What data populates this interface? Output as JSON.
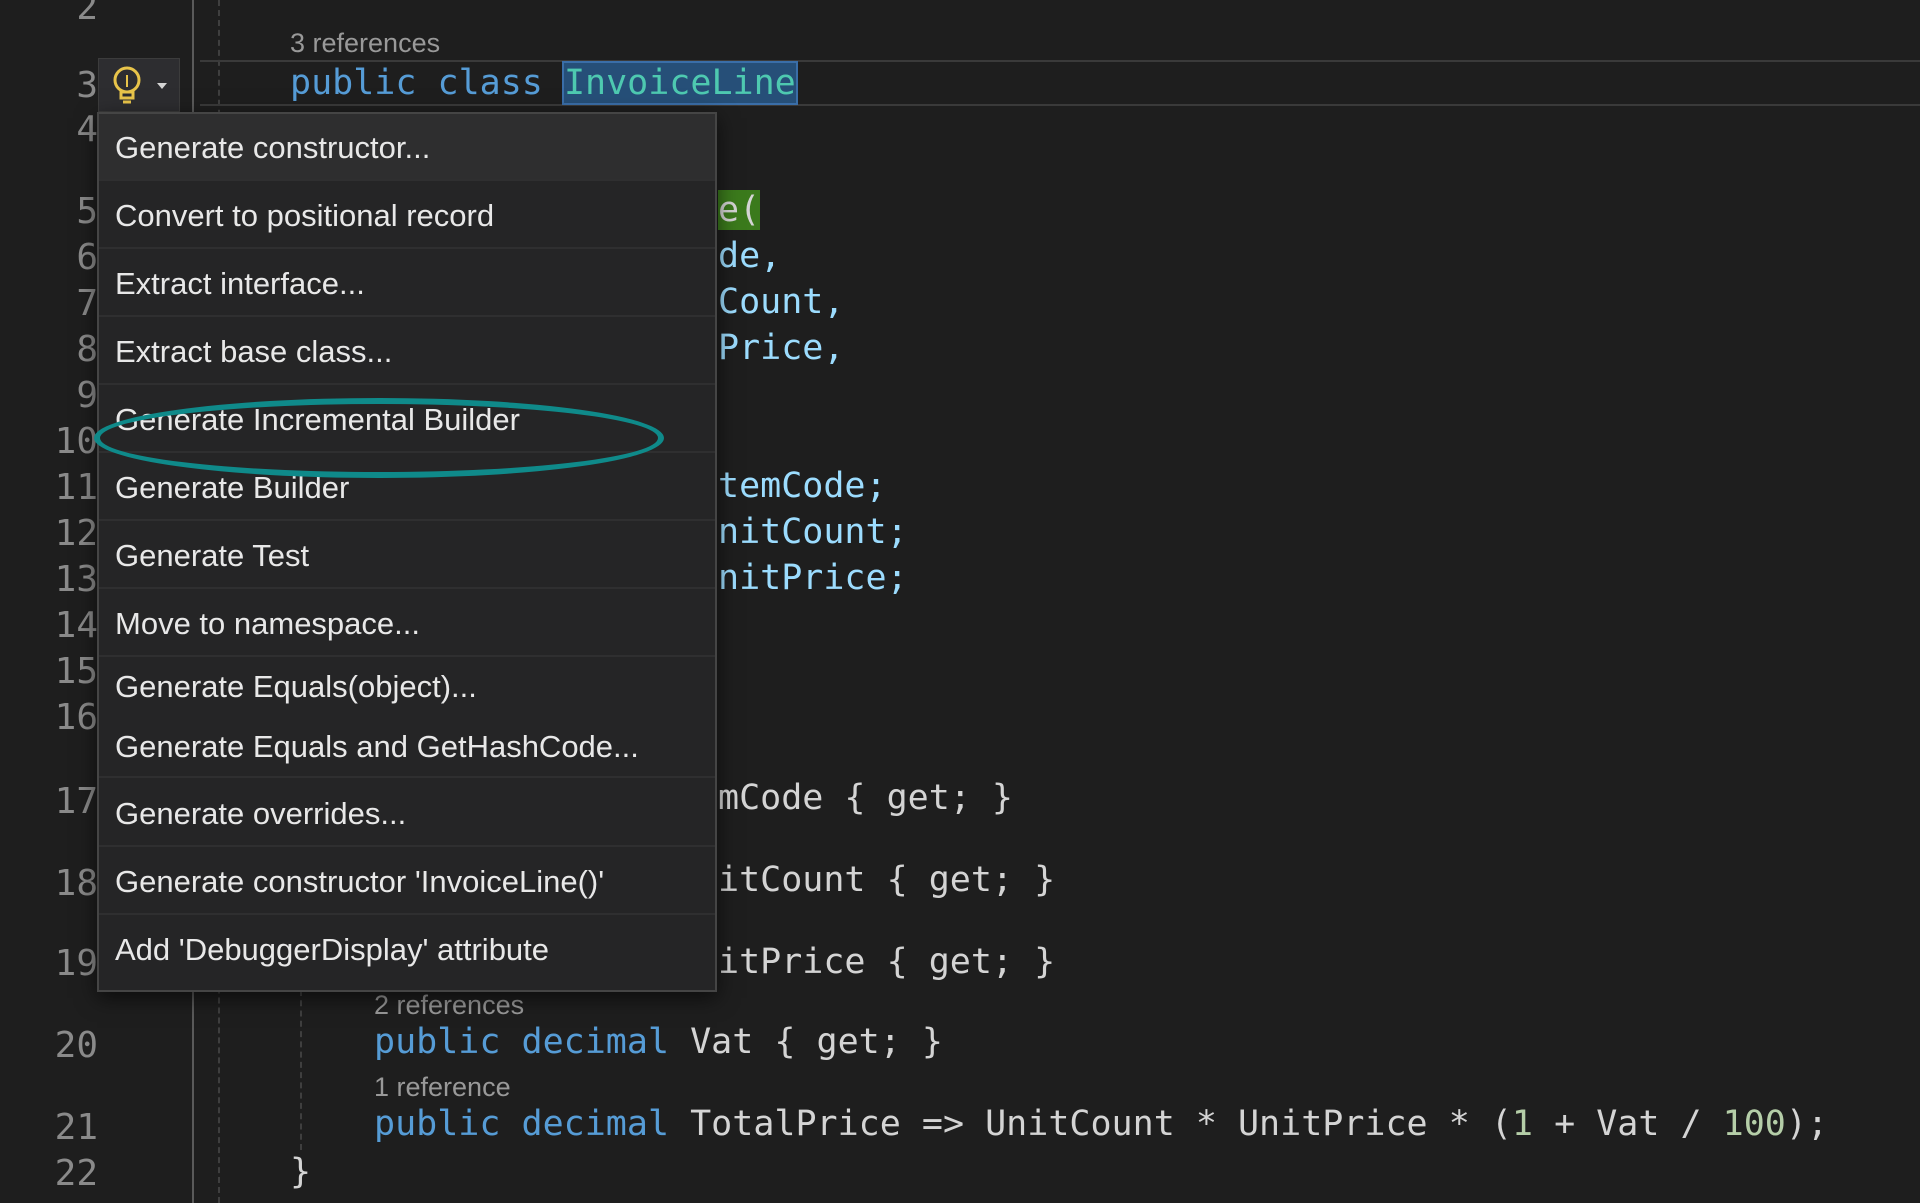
{
  "editor": {
    "line_numbers": [
      "2",
      "3",
      "4",
      "5",
      "6",
      "7",
      "8",
      "9",
      "10",
      "11",
      "12",
      "13",
      "14",
      "15",
      "16",
      "17",
      "18",
      "19",
      "20",
      "21",
      "22"
    ],
    "references": {
      "line3": "3 references",
      "line20": "2 references",
      "line21": "1 reference"
    },
    "code": {
      "line3_kw1": "public",
      "line3_kw2": "class",
      "line3_class": "InvoiceLine",
      "line5_frag": "e(",
      "line6_frag": "de,",
      "line7_frag": "Count,",
      "line8_frag": "Price,",
      "line11_frag": "temCode;",
      "line12_frag": "nitCount;",
      "line13_frag": "nitPrice;",
      "line17_frag": "mCode { get; }",
      "line18_frag": "itCount { get; }",
      "line19_frag": "itPrice { get; }",
      "line20_kw1": "public",
      "line20_kw2": "decimal",
      "line20_rest": "Vat { get; }",
      "line21_kw1": "public",
      "line21_kw2": "decimal",
      "line21_rest": "TotalPrice => UnitCount * UnitPrice * (",
      "line21_n1": "1",
      "line21_mid": " + Vat / ",
      "line21_n2": "100",
      "line21_end": ");",
      "line22": "}"
    }
  },
  "quick_actions": {
    "icon": "lightbulb-icon",
    "items": [
      "Generate constructor...",
      "Convert to positional record",
      "Extract interface...",
      "Extract base class...",
      "Generate Incremental Builder",
      "Generate Builder",
      "Generate Test",
      "Move to namespace...",
      "Generate Equals(object)...",
      "Generate Equals and GetHashCode...",
      "Generate overrides...",
      "Generate constructor 'InvoiceLine()'",
      "Add 'DebuggerDisplay' attribute"
    ],
    "highlight_color": "#0f8a8a"
  }
}
